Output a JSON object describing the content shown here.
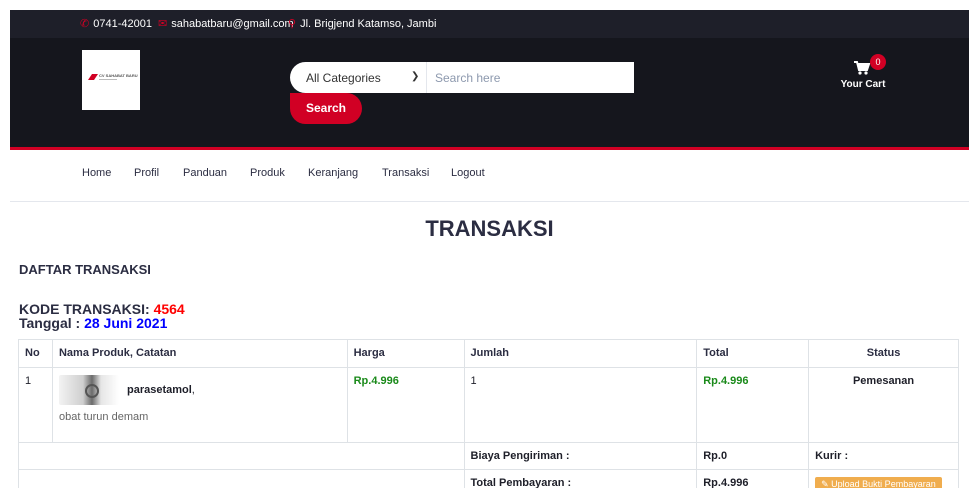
{
  "topbar": {
    "phone": "0741-42001",
    "email": "sahabatbaru@gmail.com",
    "address": "Jl. Brigjend Katamso, Jambi"
  },
  "header": {
    "logo_text": "CV SAHABAT BARU",
    "search": {
      "category": "All Categories",
      "placeholder": "Search here",
      "button": "Search"
    },
    "cart": {
      "count": "0",
      "label": "Your Cart"
    }
  },
  "nav": {
    "items": [
      "Home",
      "Profil",
      "Panduan",
      "Produk",
      "Keranjang",
      "Transaksi",
      "Logout"
    ]
  },
  "main": {
    "title": "TRANSAKSI",
    "section": "DAFTAR TRANSAKSI",
    "kode_label": "KODE TRANSAKSI:",
    "kode_value": "4564",
    "tanggal_label": "Tanggal :",
    "tanggal_value": "28 Juni 2021",
    "table": {
      "headers": [
        "No",
        "Nama Produk, Catatan",
        "Harga",
        "Jumlah",
        "Total",
        "Status"
      ],
      "rows": [
        {
          "no": "1",
          "product": "parasetamol",
          "comma": ",",
          "note": "obat turun demam",
          "harga": "Rp.4.996",
          "jumlah": "1",
          "total": "Rp.4.996",
          "status": "Pemesanan"
        }
      ],
      "shipping_label": "Biaya Pengiriman :",
      "shipping_value": "Rp.0",
      "courier_label": "Kurir :",
      "payment_label": "Total Pembayaran :",
      "payment_value": "Rp.4.996",
      "upload_label": "Upload Bukti Pembayaran"
    }
  },
  "colors": {
    "accent": "#d10024",
    "header_bg": "#15161d",
    "topbar_bg": "#1e1f29",
    "price": "#1a8a1a"
  }
}
